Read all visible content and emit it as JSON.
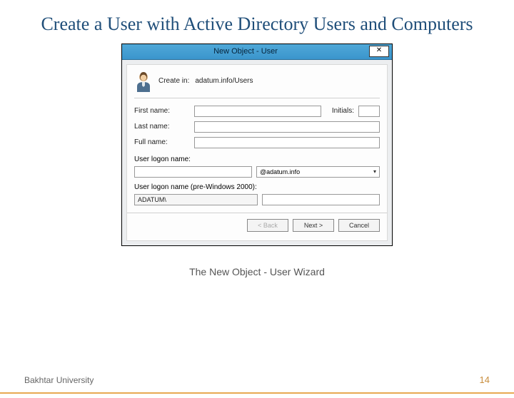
{
  "slide": {
    "title": "Create a User with Active Directory Users and Computers",
    "caption": "The New Object - User Wizard",
    "footer_left": "Bakhtar University",
    "page_number": "14"
  },
  "dialog": {
    "title": "New Object - User",
    "close_glyph": "✕",
    "create_in_label": "Create in:",
    "create_in_path": "adatum.info/Users",
    "labels": {
      "first_name": "First name:",
      "initials": "Initials:",
      "last_name": "Last name:",
      "full_name": "Full name:",
      "logon_name": "User logon name:",
      "logon_pre2000": "User logon name (pre-Windows 2000):"
    },
    "values": {
      "first_name": "",
      "initials": "",
      "last_name": "",
      "full_name": "",
      "logon_name": "",
      "domain_suffix": "@adatum.info",
      "pre2000_prefix": "ADATUM\\",
      "pre2000_name": ""
    },
    "buttons": {
      "back": "< Back",
      "next": "Next >",
      "cancel": "Cancel"
    }
  }
}
